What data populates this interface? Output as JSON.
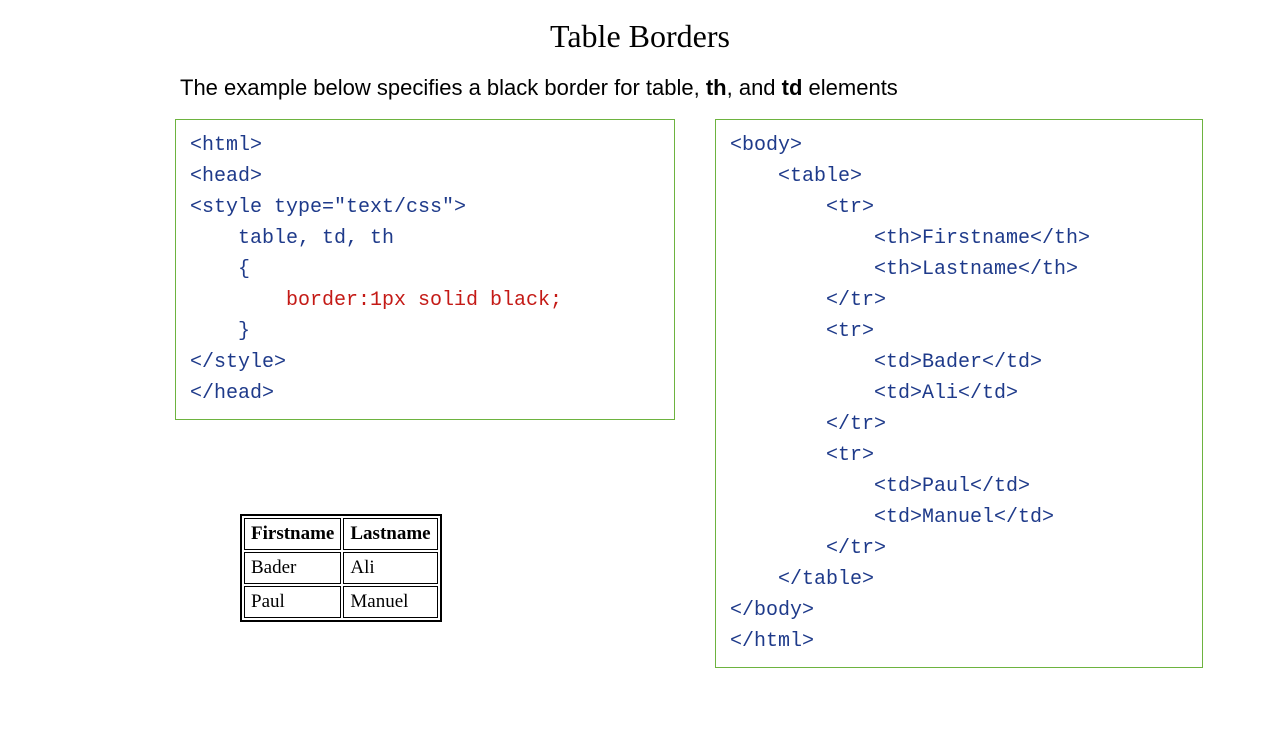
{
  "title": "Table Borders",
  "description": {
    "prefix": "The example below specifies a black border for table, ",
    "th": "th",
    "mid": ", and ",
    "td": "td",
    "suffix": " elements"
  },
  "code_left": {
    "l1": "<html>",
    "l2": "<head>",
    "l3": "<style type=\"text/css\">",
    "l4": "    table, td, th",
    "l5": "    {",
    "l6_indent": "        ",
    "l6_rule": "border:1px solid black;",
    "l7": "    }",
    "l8": "</style>",
    "l9": "</head>"
  },
  "code_right": {
    "l1": "<body>",
    "l2": "    <table>",
    "l3": "        <tr>",
    "l4": "            <th>Firstname</th>",
    "l5": "            <th>Lastname</th>",
    "l6": "        </tr>",
    "l7": "        <tr>",
    "l8": "            <td>Bader</td>",
    "l9": "            <td>Ali</td>",
    "l10": "        </tr>",
    "l11": "        <tr>",
    "l12": "            <td>Paul</td>",
    "l13": "            <td>Manuel</td>",
    "l14": "        </tr>",
    "l15": "    </table>",
    "l16": "</body>",
    "l17": "</html>"
  },
  "preview": {
    "headers": {
      "c0": "Firstname",
      "c1": "Lastname"
    },
    "rows": {
      "r0": {
        "c0": "Bader",
        "c1": "Ali"
      },
      "r1": {
        "c0": "Paul",
        "c1": "Manuel"
      }
    }
  }
}
